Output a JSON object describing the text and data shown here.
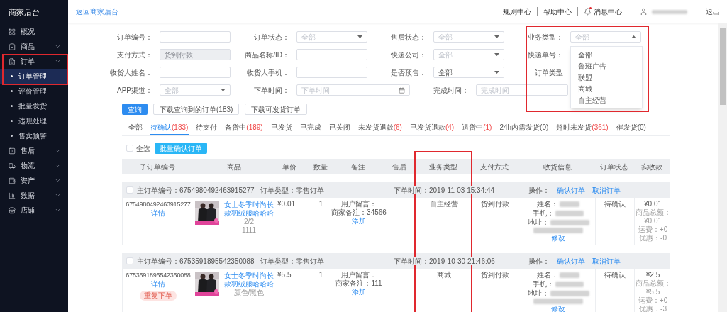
{
  "sidebar": {
    "title": "商家后台",
    "items": [
      {
        "label": "概况",
        "expandable": false
      },
      {
        "label": "商品",
        "expandable": true
      },
      {
        "label": "订单",
        "expandable": true,
        "expanded": true,
        "highlighted": true,
        "children": [
          {
            "label": "订单管理",
            "selected": true
          },
          {
            "label": "评价管理",
            "selected": false
          },
          {
            "label": "批量发货",
            "selected": false
          },
          {
            "label": "违规处理",
            "selected": false
          },
          {
            "label": "售卖预警",
            "selected": false
          }
        ]
      },
      {
        "label": "售后",
        "expandable": true
      },
      {
        "label": "物流",
        "expandable": true
      },
      {
        "label": "资产",
        "expandable": true
      },
      {
        "label": "数据",
        "expandable": true
      },
      {
        "label": "店铺",
        "expandable": true
      }
    ]
  },
  "topbar": {
    "back_link": "返回商家后台",
    "links": [
      {
        "label": "规则中心"
      },
      {
        "label": "帮助中心"
      },
      {
        "label": "消息中心",
        "unread": true
      }
    ],
    "logout": "退出"
  },
  "filters": {
    "rows": [
      [
        {
          "label": "订单编号：",
          "kind": "text"
        },
        {
          "label": "订单状态：",
          "kind": "select",
          "placeholder": "全部"
        },
        {
          "label": "售后状态：",
          "kind": "select",
          "placeholder": "全部"
        },
        {
          "label": "业务类型：",
          "kind": "select",
          "placeholder": "全部",
          "open": true,
          "highlighted": true,
          "options": [
            "全部",
            "鲁班广告",
            "联盟",
            "商城",
            "自主经营"
          ]
        }
      ],
      [
        {
          "label": "支付方式：",
          "kind": "disabled",
          "placeholder": "货到付款"
        },
        {
          "label": "商品名称/ID：",
          "kind": "text"
        },
        {
          "label": "快递公司：",
          "kind": "select",
          "placeholder": "全部"
        },
        {
          "label": "快递单号：",
          "kind": "label_only"
        }
      ],
      [
        {
          "label": "收货人姓名：",
          "kind": "text"
        },
        {
          "label": "收货人手机：",
          "kind": "text"
        },
        {
          "label": "是否预售：",
          "kind": "select",
          "value": "全部"
        },
        {
          "label": "订单类型",
          "kind": "label_only"
        }
      ],
      [
        {
          "label": "APP渠道：",
          "kind": "select",
          "placeholder": "全部"
        },
        {
          "label": "下单时间：",
          "kind": "date",
          "placeholder": "下单时间"
        },
        {
          "label": "完成时间：",
          "kind": "date",
          "placeholder": "完成时间",
          "partly_hidden": true
        }
      ]
    ]
  },
  "buttons": [
    {
      "label": "查询",
      "kind": "primary"
    },
    {
      "label": "下载查询到的订单(183)",
      "kind": "default"
    },
    {
      "label": "下载可发货订单",
      "kind": "default"
    }
  ],
  "tabs": [
    {
      "label": "全部",
      "selected": false
    },
    {
      "label": "待确认",
      "count": "(183)",
      "count_alert": true,
      "selected": true
    },
    {
      "label": "待支付",
      "selected": false
    },
    {
      "label": "备货中",
      "count": "(189)",
      "count_alert": true,
      "selected": false
    },
    {
      "label": "已发货",
      "selected": false
    },
    {
      "label": "已完成",
      "selected": false
    },
    {
      "label": "已关闭",
      "selected": false
    },
    {
      "label": "未发货退款",
      "count": "(6)",
      "count_alert": true,
      "selected": false
    },
    {
      "label": "已发货退款",
      "count": "(4)",
      "count_alert": true,
      "selected": false
    },
    {
      "label": "退货中",
      "count": "(1)",
      "count_alert": true,
      "selected": false
    },
    {
      "label": "24h内需发货",
      "count": "(0)",
      "count_alert": false,
      "selected": false
    },
    {
      "label": "超时未发货",
      "count": "(361)",
      "count_alert": true,
      "selected": false
    },
    {
      "label": "催发货",
      "count": "(0)",
      "count_alert": false,
      "selected": false
    }
  ],
  "toolbar": {
    "select_all": {
      "label": "全选",
      "checked": false
    },
    "batch_button": "批量确认订单"
  },
  "table": {
    "columns": [
      {
        "label": "子订单编号"
      },
      {
        "label": "商品"
      },
      {
        "label": "单价"
      },
      {
        "label": "数量"
      },
      {
        "label": "备注"
      },
      {
        "label": "售后"
      },
      {
        "label": "业务类型",
        "highlighted": true
      },
      {
        "label": "支付方式"
      },
      {
        "label": "收货信息"
      },
      {
        "label": "订单状态"
      },
      {
        "label": "实收款"
      }
    ],
    "orders": [
      {
        "checked": false,
        "order_number": "主订单编号：6754980492463915277",
        "order_type": "订单类型：零售订单",
        "order_time": "下单时间：2019-11-03 15:34:44",
        "actions_label": "操作：",
        "actions": [
          "确认订单",
          "取消订单"
        ],
        "sub_order_number": "6754980492463915277",
        "detail_link": "详情",
        "product_title": "女士冬季时尚长款羽绒服哈哈哈",
        "product_lines": [
          "2/2",
          "1111"
        ],
        "price": "¥0.01",
        "quantity": "1",
        "user_remark": "用户留言：",
        "merchant_remark": "商家备注：34566",
        "add_link": "添加",
        "business_type": "自主经营",
        "payment": "货到付款",
        "receiver_labels": [
          "姓名：",
          "手机：",
          "地址："
        ],
        "edit_link": "修改",
        "status": "待确认",
        "amount": "¥0.01",
        "amount_lines": [
          "商品总额：",
          "¥0.01",
          "运费：+0",
          "优惠：-0"
        ]
      },
      {
        "checked": false,
        "order_number": "主订单编号：6753591895542350088",
        "order_type": "订单类型：零售订单",
        "order_time": "下单时间：2019-10-30 21:46:06",
        "actions_label": "操作：",
        "actions": [
          "确认订单",
          "取消订单"
        ],
        "sub_order_number": "6753591895542350088",
        "detail_link": "详情",
        "reorder_button": "重复下单",
        "product_title": "女士冬季时尚长款羽绒服哈哈哈",
        "product_lines": [
          "颜色/黑色"
        ],
        "price": "¥5.5",
        "quantity": "1",
        "user_remark": "用户留言：",
        "merchant_remark": "商家备注：111",
        "add_link": "添加",
        "business_type": "商城",
        "payment": "货到付款",
        "receiver_labels": [
          "姓名：",
          "手机：",
          "地址："
        ],
        "edit_link": "修改",
        "status": "待确认",
        "amount": "¥2.5",
        "amount_lines": [
          "商品总额：",
          "¥5.5",
          "运费：+0",
          "优惠：-3"
        ]
      }
    ]
  }
}
